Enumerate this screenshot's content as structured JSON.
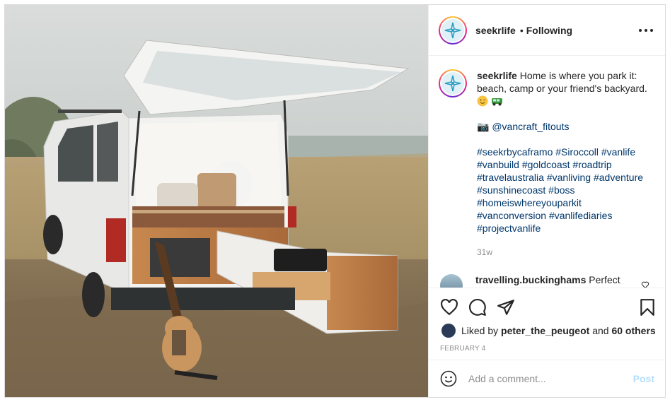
{
  "post": {
    "username": "seekrlife",
    "separator": "•",
    "follow_status": "Following",
    "caption": {
      "username": "seekrlife",
      "text_line": "Home is where you park it: beach, camp or your friend's backyard.",
      "camera_glyph": "📷",
      "mention": "@vancraft_fitouts",
      "hashtags": "#seekrbycaframo #Siroccoll #vanlife #vanbuild #goldcoast #roadtrip #travelaustralia #vanliving #adventure #sunshinecoast #boss #homeiswhereyoupark it #vanconversion #vanlifediaries #projectvanlife"
    },
    "hashtag_lines": [
      "#seekrbycaframo #Siroccoll #vanlife",
      "#vanbuild #goldcoast #roadtrip",
      "#travelaustralia #vanliving #adventure",
      "#sunshinecoast #boss",
      "#homeiswhereyouparkit",
      "#vanconversion #vanlifediaries",
      "#projectvanlife"
    ],
    "caption_time": "31w",
    "comment": {
      "username": "travelling.buckinghams",
      "text": "Perfect"
    },
    "likes": {
      "prefix": "Liked by",
      "user": "peter_the_peugeot",
      "joiner": "and",
      "others": "60 others"
    },
    "date": "FEBRUARY 4",
    "add_comment_placeholder": "Add a comment...",
    "post_label": "Post"
  },
  "icons": {
    "more": "more-horizontal-icon",
    "like": "heart-icon",
    "comment": "comment-bubble-icon",
    "share": "paper-plane-icon",
    "save": "bookmark-icon",
    "emoji": "smiley-icon"
  },
  "colors": {
    "link": "#00376b",
    "muted": "#8e8e8e",
    "post_disabled": "#b2dffc"
  }
}
